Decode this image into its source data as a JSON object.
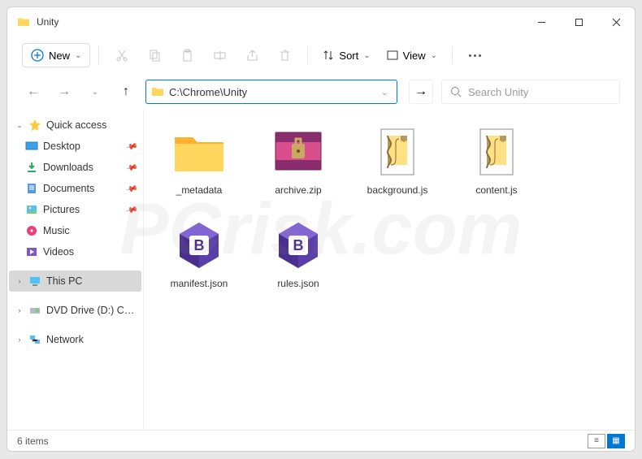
{
  "window": {
    "title": "Unity"
  },
  "toolbar": {
    "new_label": "New",
    "sort_label": "Sort",
    "view_label": "View"
  },
  "address": {
    "path": "C:\\Chrome\\Unity"
  },
  "search": {
    "placeholder": "Search Unity"
  },
  "sidebar": {
    "quick_access": "Quick access",
    "items": [
      {
        "label": "Desktop",
        "icon": "desktop"
      },
      {
        "label": "Downloads",
        "icon": "downloads"
      },
      {
        "label": "Documents",
        "icon": "documents"
      },
      {
        "label": "Pictures",
        "icon": "pictures"
      },
      {
        "label": "Music",
        "icon": "music"
      },
      {
        "label": "Videos",
        "icon": "videos"
      }
    ],
    "this_pc": "This PC",
    "dvd": "DVD Drive (D:) CCCC",
    "network": "Network"
  },
  "files": [
    {
      "name": "_metadata",
      "type": "folder"
    },
    {
      "name": "archive.zip",
      "type": "zip"
    },
    {
      "name": "background.js",
      "type": "js"
    },
    {
      "name": "content.js",
      "type": "js"
    },
    {
      "name": "manifest.json",
      "type": "json"
    },
    {
      "name": "rules.json",
      "type": "json"
    }
  ],
  "status": {
    "count": "6 items"
  },
  "watermark": "PCrisk.com"
}
